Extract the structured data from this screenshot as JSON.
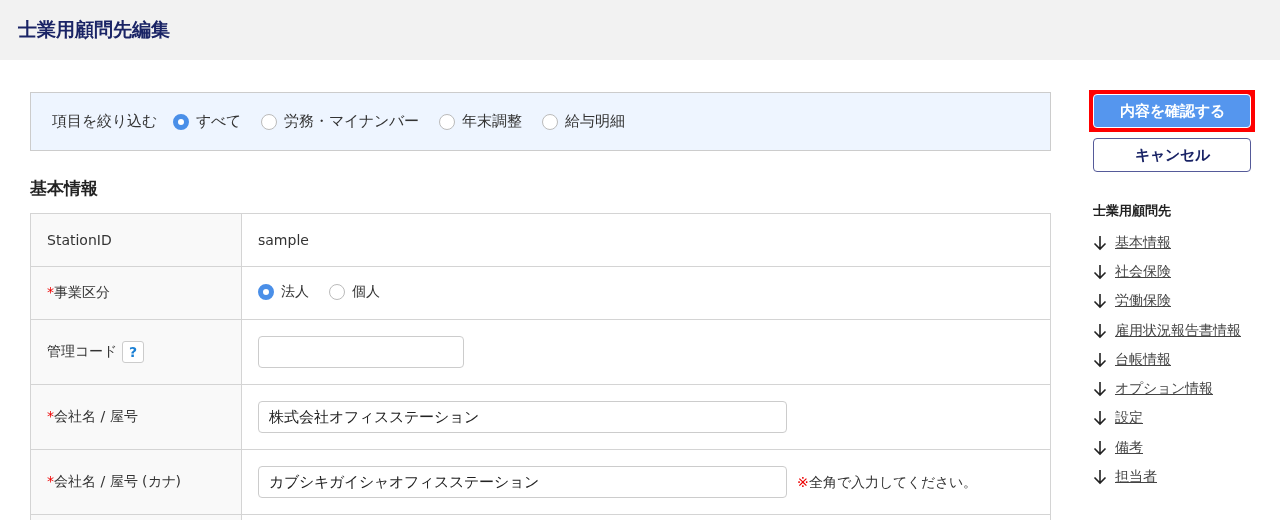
{
  "page_title": "士業用顧問先編集",
  "filter": {
    "label": "項目を絞り込む",
    "options": [
      {
        "label": "すべて",
        "selected": true
      },
      {
        "label": "労務・マイナンバー",
        "selected": false
      },
      {
        "label": "年末調整",
        "selected": false
      },
      {
        "label": "給与明細",
        "selected": false
      }
    ]
  },
  "section_title": "基本情報",
  "rows": [
    {
      "kind": "text",
      "label": "StationID",
      "value": "sample"
    },
    {
      "kind": "radio",
      "label": "事業区分",
      "required_mark": "*",
      "options": [
        {
          "label": "法人",
          "selected": true
        },
        {
          "label": "個人",
          "selected": false
        }
      ]
    },
    {
      "kind": "short_input",
      "label": "管理コード",
      "help": "?",
      "value": ""
    },
    {
      "kind": "input",
      "label": "会社名 / 屋号",
      "required_mark": "*",
      "value": "株式会社オフィスステーション"
    },
    {
      "kind": "input",
      "label": "会社名 / 屋号 (カナ)",
      "required_mark": "*",
      "value": "カブシキガイシャオフィスステーション",
      "note": {
        "mark": "※",
        "text": "全角で入力してください。"
      }
    }
  ],
  "actions": {
    "confirm": {
      "label": "内容を確認する",
      "highlighted": true
    },
    "cancel": {
      "label": "キャンセル"
    }
  },
  "nav": {
    "title": "士業用顧問先",
    "links": [
      "基本情報",
      "社会保険",
      "労働保険",
      "雇用状況報告書情報",
      "台帳情報",
      "オプション情報",
      "設定",
      "備考",
      "担当者"
    ]
  }
}
